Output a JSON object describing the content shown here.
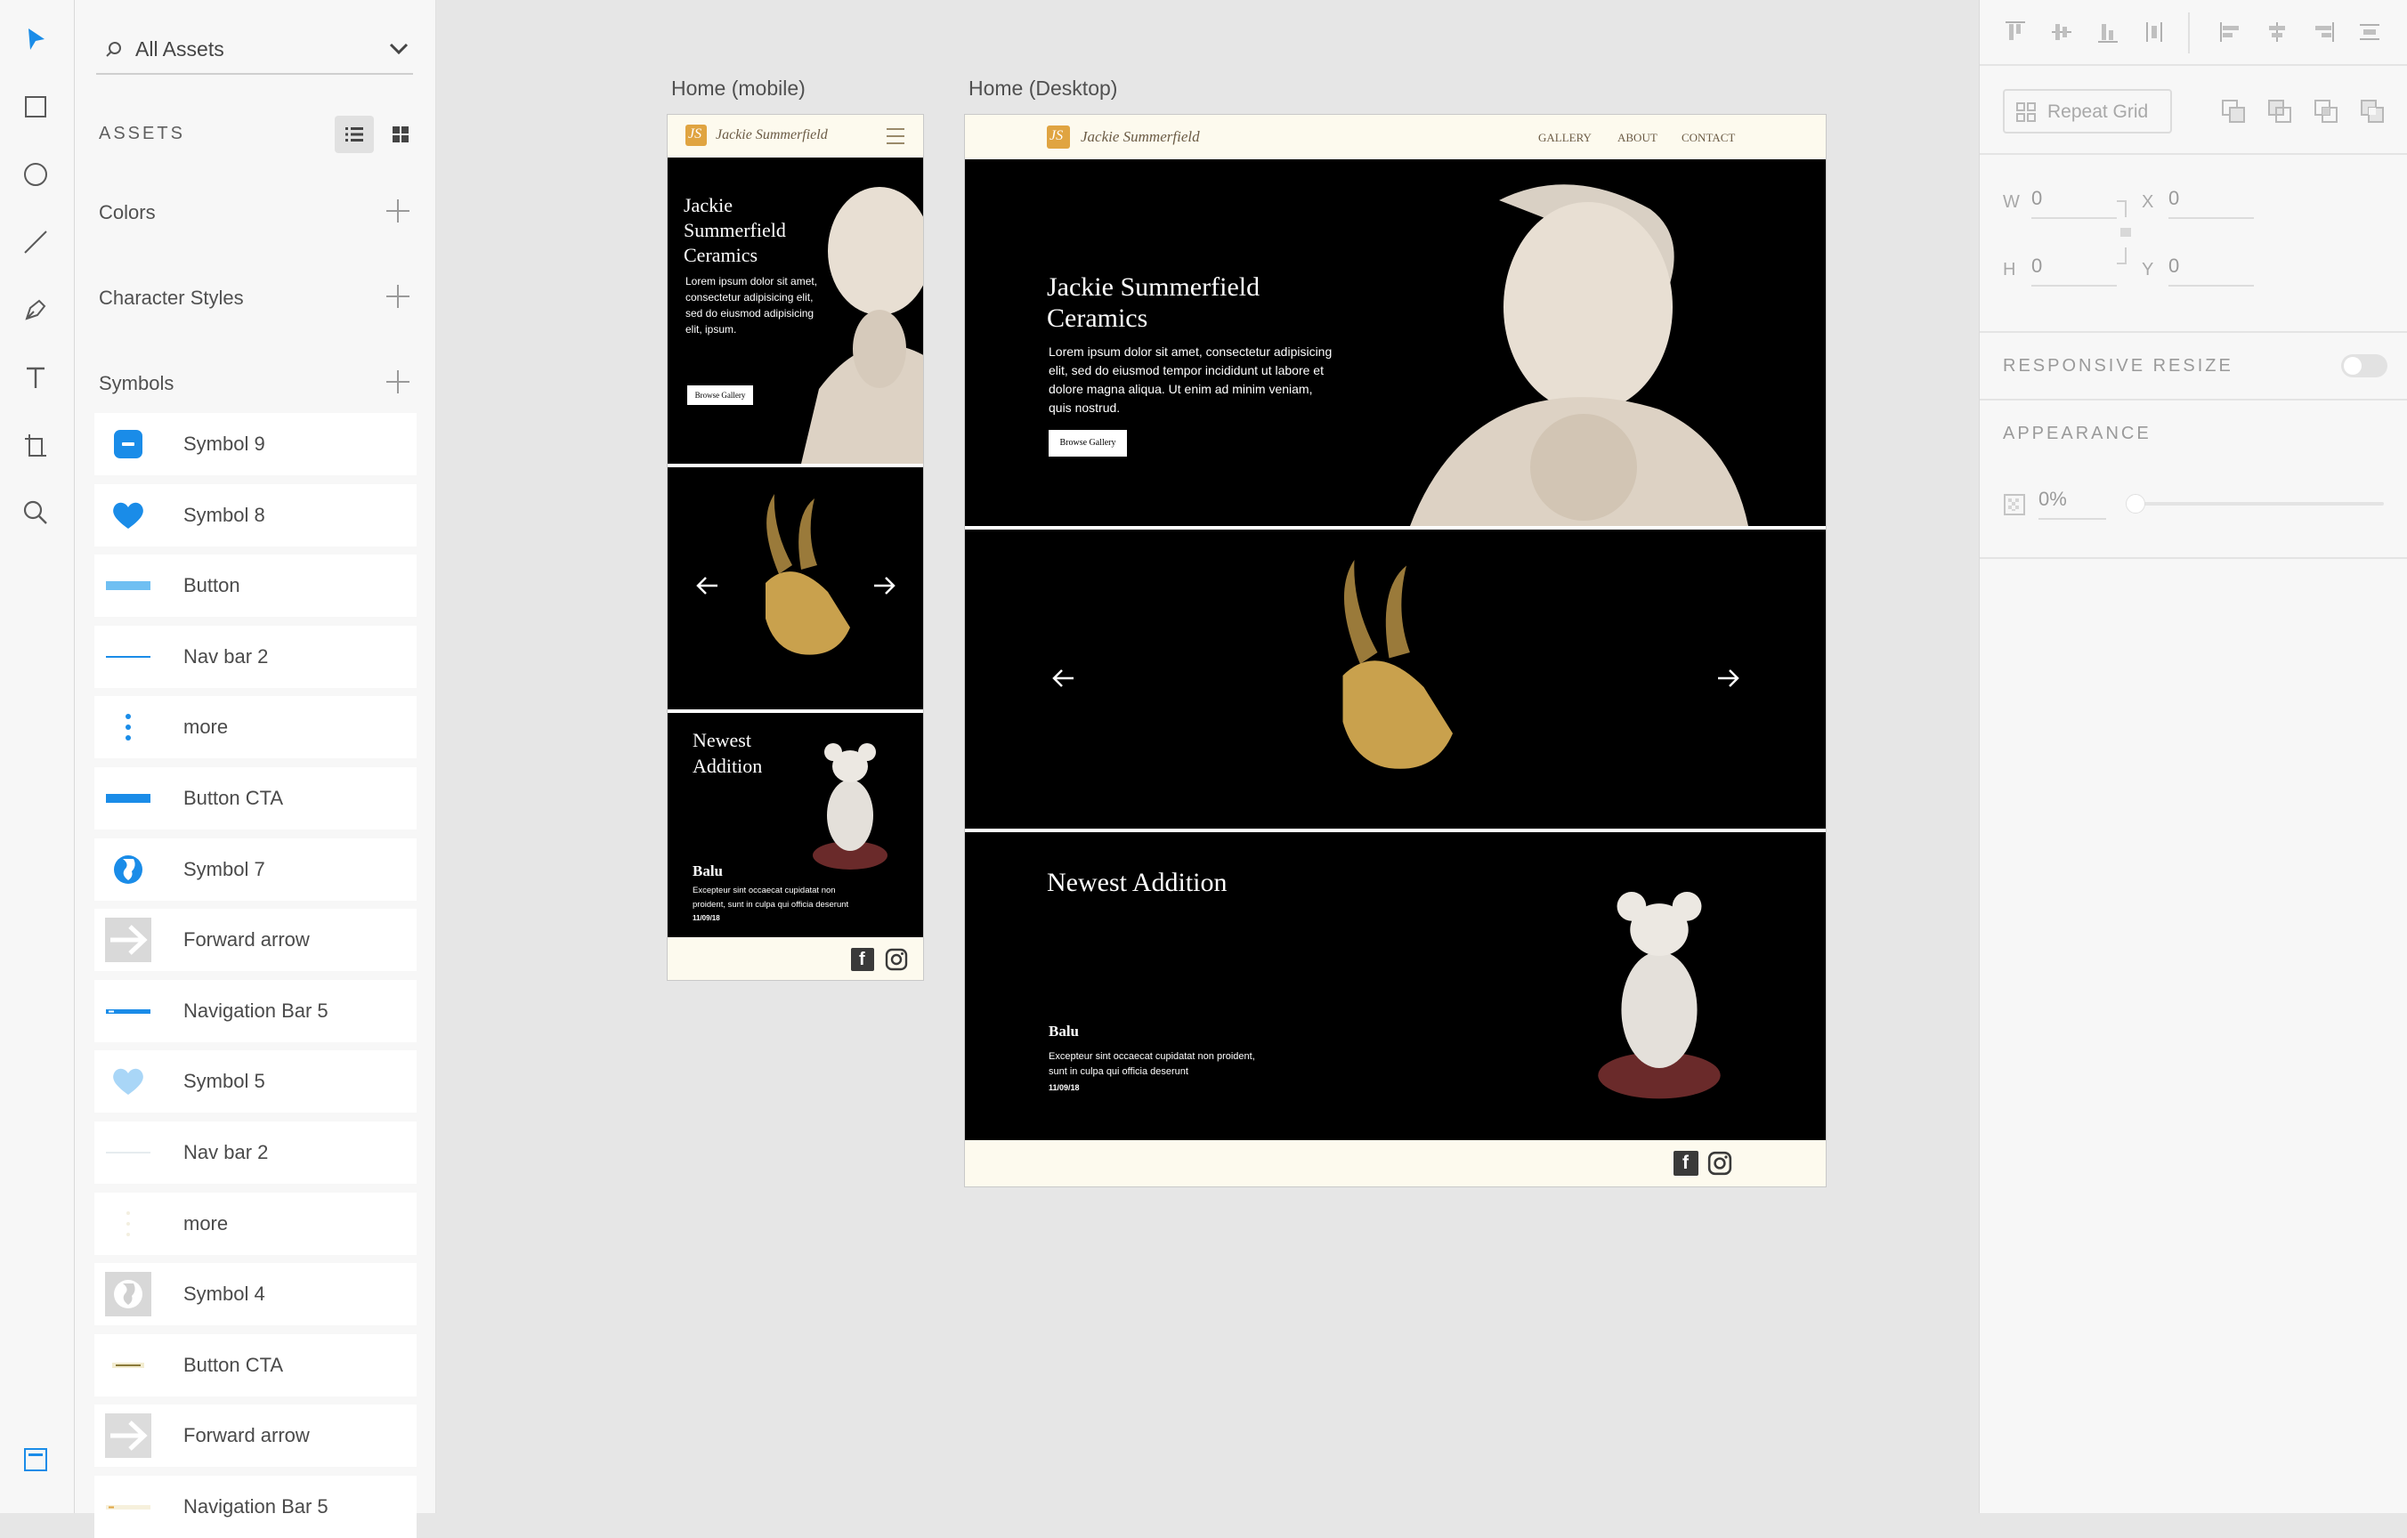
{
  "toolbar": {
    "tools": [
      "select-icon",
      "rectangle-icon",
      "ellipse-icon",
      "line-icon",
      "pen-icon",
      "text-icon",
      "artboard-icon",
      "zoom-icon"
    ],
    "bottom": "assets-panel-icon"
  },
  "assets": {
    "filter_label": "All Assets",
    "header": "ASSETS",
    "colors_label": "Colors",
    "char_styles_label": "Character Styles",
    "symbols_label": "Symbols",
    "symbols": [
      {
        "name": "Symbol 9",
        "thumb": "blue-square"
      },
      {
        "name": "Symbol 8",
        "thumb": "heart"
      },
      {
        "name": "Button",
        "thumb": "button"
      },
      {
        "name": "Nav bar 2",
        "thumb": "line"
      },
      {
        "name": "more",
        "thumb": "dots"
      },
      {
        "name": "Button CTA",
        "thumb": "cta"
      },
      {
        "name": "Symbol 7",
        "thumb": "globe"
      },
      {
        "name": "Forward arrow",
        "thumb": "arrow"
      },
      {
        "name": "Navigation Bar 5",
        "thumb": "navbar"
      },
      {
        "name": "Symbol 5",
        "thumb": "heart-light"
      },
      {
        "name": "Nav bar 2",
        "thumb": "line-light"
      },
      {
        "name": "more",
        "thumb": "dots-light"
      },
      {
        "name": "Symbol 4",
        "thumb": "globe-gray"
      },
      {
        "name": "Button CTA",
        "thumb": "cta-light"
      },
      {
        "name": "Forward arrow",
        "thumb": "arrow-gray"
      },
      {
        "name": "Navigation Bar 5",
        "thumb": "navbar-light"
      }
    ]
  },
  "canvas": {
    "mobile": {
      "label": "Home (mobile)",
      "brand": "Jackie Summerfield",
      "hero_title": "Jackie Summerfield Ceramics",
      "hero_text": "Lorem ipsum dolor sit amet, consectetur adipisicing elit, sed do eiusmod adipisicing elit, ipsum.",
      "cta": "Browse Gallery",
      "newest_title": "Newest Addition",
      "item_name": "Balu",
      "item_text": "Excepteur sint occaecat cupidatat non proident, sunt in culpa qui officia deserunt",
      "item_date": "11/09/18"
    },
    "desktop": {
      "label": "Home (Desktop)",
      "brand": "Jackie Summerfield",
      "nav": [
        "GALLERY",
        "ABOUT",
        "CONTACT"
      ],
      "hero_title": "Jackie Summerfield Ceramics",
      "hero_text": "Lorem ipsum dolor sit amet, consectetur adipisicing elit, sed do eiusmod tempor incididunt ut labore et dolore magna aliqua. Ut enim ad minim veniam, quis nostrud.",
      "cta": "Browse Gallery",
      "newest_title": "Newest Addition",
      "item_name": "Balu",
      "item_text": "Excepteur sint occaecat cupidatat non proident, sunt in culpa qui officia deserunt",
      "item_date": "11/09/18"
    }
  },
  "props": {
    "repeat_grid": "Repeat Grid",
    "w_label": "W",
    "w": "0",
    "x_label": "X",
    "x": "0",
    "h_label": "H",
    "h": "0",
    "y_label": "Y",
    "y": "0",
    "responsive_resize": "RESPONSIVE RESIZE",
    "responsive_on": false,
    "appearance": "APPEARANCE",
    "opacity": "0%",
    "opacity_value": 0
  },
  "colors": {
    "accent": "#1a8ce8",
    "panel": "#f7f7f7",
    "canvas": "#e6e6e6",
    "cream": "#fdfaee",
    "gold": "#e0a441"
  }
}
